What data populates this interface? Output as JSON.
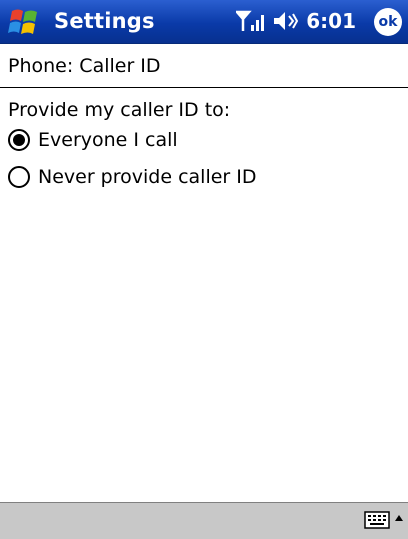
{
  "titlebar": {
    "title": "Settings",
    "time": "6:01",
    "ok_label": "ok"
  },
  "page": {
    "title": "Phone: Caller ID"
  },
  "caller_id": {
    "group_label": "Provide my caller ID to:",
    "options": [
      {
        "label": "Everyone I call",
        "selected": true
      },
      {
        "label": "Never provide caller ID",
        "selected": false
      }
    ]
  },
  "colors": {
    "titlebar": "#0a3aa8",
    "bottom_bar": "#c8c8c8"
  }
}
